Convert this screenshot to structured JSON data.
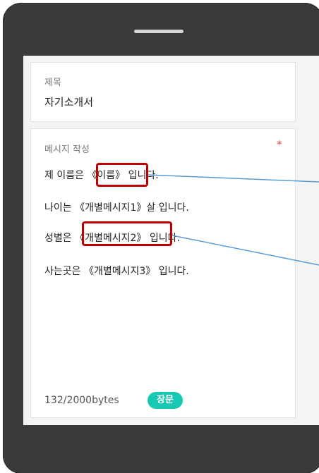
{
  "title_section": {
    "label": "제목",
    "value": "자기소개서"
  },
  "message_section": {
    "label": "메시지 작성",
    "required_mark": "*",
    "lines": [
      "제 이름은 《이름》 입니다.",
      "나이는 《개별메시지1》살 입니다.",
      "성별은 《개별메시지2》 입니다.",
      "사는곳은 《개별메시지3》 입니다."
    ],
    "byte_count": "132/2000bytes",
    "type_badge": "장문"
  },
  "colors": {
    "highlight": "#c00000",
    "arrow": "#5b9bd5",
    "badge": "#18c8b4",
    "required": "#e8463f"
  }
}
